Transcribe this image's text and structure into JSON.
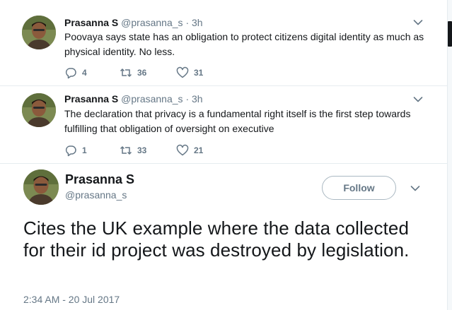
{
  "tweets": [
    {
      "name": "Prasanna S",
      "handle": "@prasanna_s",
      "dot": "·",
      "time": "3h",
      "text": "Poovaya says state has an obligation to protect citizens digital identity as much as physical identity. No less.",
      "replies": "4",
      "retweets": "36",
      "likes": "31"
    },
    {
      "name": "Prasanna S",
      "handle": "@prasanna_s",
      "dot": "·",
      "time": "3h",
      "text": "The declaration that privacy is a fundamental right itself is the first step towards fulfilling that obligation of oversight on executive",
      "replies": "1",
      "retweets": "33",
      "likes": "21"
    }
  ],
  "main": {
    "name": "Prasanna S",
    "handle": "@prasanna_s",
    "follow_label": "Follow",
    "text": "Cites the UK example where the data collected for their id project was destroyed by legislation.",
    "timestamp": "2:34 AM - 20 Jul 2017"
  },
  "colors": {
    "text_primary": "#14171a",
    "text_secondary": "#657786",
    "border": "#e6ecf0",
    "button_border": "#aab8c2"
  },
  "icons": [
    "avatar",
    "chevron-down-icon",
    "reply-icon",
    "retweet-icon",
    "like-icon"
  ]
}
